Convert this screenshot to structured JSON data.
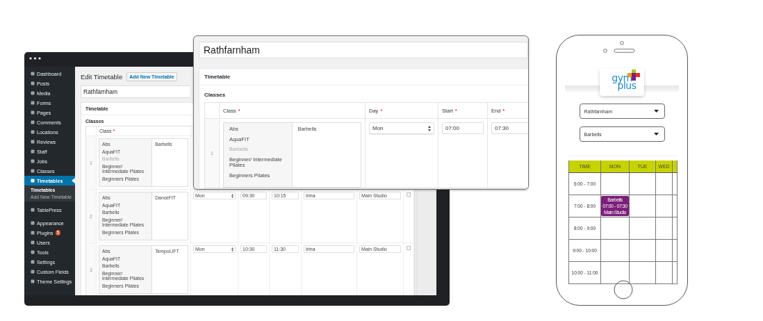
{
  "admin": {
    "sidebar": [
      {
        "label": "Dashboard",
        "selected": false
      },
      {
        "label": "Posts",
        "selected": false
      },
      {
        "label": "Media",
        "selected": false
      },
      {
        "label": "Forms",
        "selected": false
      },
      {
        "label": "Pages",
        "selected": false
      },
      {
        "label": "Comments",
        "selected": false
      },
      {
        "label": "Locations",
        "selected": false
      },
      {
        "label": "Reviews",
        "selected": false
      },
      {
        "label": "Staff",
        "selected": false
      },
      {
        "label": "Jobs",
        "selected": false
      },
      {
        "label": "Classes",
        "selected": false
      },
      {
        "label": "Timetables",
        "selected": true,
        "children": [
          {
            "label": "Timetables",
            "selected": true
          },
          {
            "label": "Add New Timetable",
            "selected": false
          }
        ]
      },
      {
        "label": "TablePress",
        "selected": false
      },
      {
        "label": "Appearance",
        "selected": false
      },
      {
        "label": "Plugins",
        "selected": false,
        "badge": "5"
      },
      {
        "label": "Users",
        "selected": false
      },
      {
        "label": "Tools",
        "selected": false
      },
      {
        "label": "Settings",
        "selected": false
      },
      {
        "label": "Custom Fields",
        "selected": false
      },
      {
        "label": "Theme Settings",
        "selected": false
      }
    ],
    "editor": {
      "heading": "Edit Timetable",
      "add_button": "Add New Timetable",
      "title": "Rathfarnham",
      "metabox_title": "Timetable",
      "field_label": "Classes",
      "columns": [
        {
          "label": "Class",
          "mark": "*"
        }
      ],
      "rows": [
        {
          "number": "1",
          "class_options": [
            {
              "label": "Abs",
              "disabled": false
            },
            {
              "label": "AquaFIT",
              "disabled": false
            },
            {
              "label": "Barbells",
              "disabled": true
            },
            {
              "label": "Beginner/ Intermediate Pilates",
              "disabled": false
            },
            {
              "label": "Beginners Pilates",
              "disabled": false
            }
          ],
          "selected_class": "Barbells"
        },
        {
          "number": "2",
          "class_options": [
            {
              "label": "Abs",
              "disabled": false
            },
            {
              "label": "AquaFIT",
              "disabled": false
            },
            {
              "label": "Barbells",
              "disabled": false
            },
            {
              "label": "Beginner/ Intermediate Pilates",
              "disabled": false
            },
            {
              "label": "Beginners Pilates",
              "disabled": false
            }
          ],
          "selected_class": "DanceFIT",
          "day": "Mon",
          "start": "09:30",
          "end": "10:15",
          "instructor": "Irina",
          "location": "Main Studio",
          "checked": false
        },
        {
          "number": "3",
          "class_options": [
            {
              "label": "Abs",
              "disabled": false
            },
            {
              "label": "AquaFIT",
              "disabled": false
            },
            {
              "label": "Barbells",
              "disabled": false
            },
            {
              "label": "Beginner/ Intermediate Pilates",
              "disabled": false
            },
            {
              "label": "Beginners Pilates",
              "disabled": false
            }
          ],
          "selected_class": "TempoLIFT",
          "day": "Mon",
          "start": "10:30",
          "end": "11:30",
          "instructor": "Irina",
          "location": "Main Studio",
          "checked": false
        }
      ]
    }
  },
  "zoom": {
    "title": "Rathfarnham",
    "metabox_title": "Timetable",
    "field_label": "Classes",
    "columns": [
      {
        "label": "Class",
        "mark": "*"
      },
      {
        "label": "Day",
        "mark": "*"
      },
      {
        "label": "Start",
        "mark": "*"
      },
      {
        "label": "End",
        "mark": "*"
      }
    ],
    "row": {
      "number": "1",
      "class_options": [
        {
          "label": "Abs",
          "disabled": false
        },
        {
          "label": "AquaFIT",
          "disabled": false
        },
        {
          "label": "Barbells",
          "disabled": true
        },
        {
          "label": "Beginner/ Intermediate Pilates",
          "disabled": false
        },
        {
          "label": "Beginners Pilates",
          "disabled": false
        }
      ],
      "selected_class": "Barbells",
      "day": "Mon",
      "start": "07:00",
      "end": "07:30"
    }
  },
  "phone": {
    "logo": {
      "top": "gym",
      "bottom": "plus"
    },
    "selects": [
      "Rathfarnham",
      "Barbells"
    ],
    "columns": [
      "TIME",
      "MON",
      "TUE",
      "WED"
    ],
    "rows": [
      {
        "time": "6:00 - 7:00",
        "slots": [
          {
            "kind": "empty"
          },
          {
            "kind": "empty"
          },
          {
            "kind": "empty"
          }
        ]
      },
      {
        "time": "7:00 - 8:00",
        "slots": [
          {
            "kind": "event",
            "title": "Barbells",
            "time": "07:00 - 07:30",
            "location": "Main Studio",
            "color": "#7b1f7a"
          },
          {
            "kind": "empty"
          },
          {
            "kind": "empty"
          }
        ]
      },
      {
        "time": "8:00 - 9:00",
        "slots": [
          {
            "kind": "empty"
          },
          {
            "kind": "empty"
          },
          {
            "kind": "empty"
          }
        ]
      },
      {
        "time": "9:00 - 10:00",
        "slots": [
          {
            "kind": "empty"
          },
          {
            "kind": "empty"
          },
          {
            "kind": "empty"
          }
        ]
      },
      {
        "time": "10:00 - 11:00",
        "slots": [
          {
            "kind": "empty"
          },
          {
            "kind": "empty"
          },
          {
            "kind": "empty"
          }
        ]
      }
    ]
  }
}
